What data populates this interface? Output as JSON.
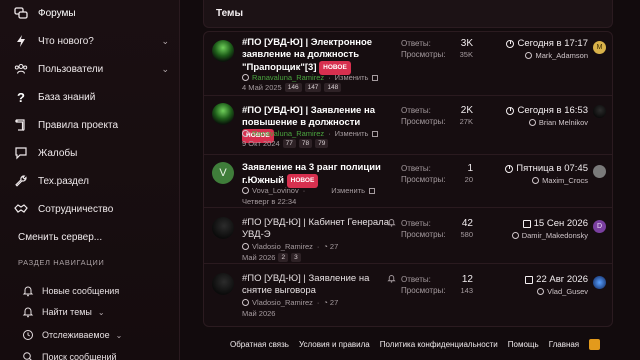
{
  "sidebar": {
    "items": [
      {
        "label": "Форумы",
        "icon": "chat-bubbles-icon"
      },
      {
        "label": "Что нового?",
        "icon": "lightning-icon"
      },
      {
        "label": "Пользователи",
        "icon": "users-icon"
      },
      {
        "label": "База знаний",
        "icon": "question-icon"
      },
      {
        "label": "Правила проекта",
        "icon": "scroll-icon"
      },
      {
        "label": "Жалобы",
        "icon": "chat-warning-icon"
      },
      {
        "label": "Тех.раздел",
        "icon": "wrench-icon"
      },
      {
        "label": "Сотрудничество",
        "icon": "handshake-icon"
      }
    ],
    "change_server": "Сменить сервер...",
    "nav_heading": "РАЗДЕЛ НАВИГАЦИИ",
    "nav_items": [
      {
        "label": "Новые сообщения",
        "icon": "bell-outline-icon"
      },
      {
        "label": "Найти темы",
        "icon": "bell-outline-icon"
      },
      {
        "label": "Отслеживаемое",
        "icon": "clock-icon"
      },
      {
        "label": "Поиск сообщений",
        "icon": "search-icon"
      }
    ]
  },
  "main": {
    "header": "Темы",
    "labels": {
      "replies": "Ответы:",
      "views": "Просмотры:",
      "edit": "Изменить",
      "new_badge": "НОВОЕ"
    },
    "threads": [
      {
        "title": "#ПО [УВД-Ю] | Электронное заявление на должность \"Прапорщик\"[3]",
        "is_new": true,
        "author": "Ranavaluna_Ramirez",
        "author_green": true,
        "date": "4 Май 2025",
        "pages": [
          "146",
          "147",
          "148"
        ],
        "replies": "3K",
        "views": "35K",
        "last_date": "Сегодня в 17:17",
        "last_user": "Mark_Adamson",
        "mini_avatar": "M",
        "mini_color": "#d9b24a"
      },
      {
        "title": "#ПО [УВД-Ю] | Заявление на повышение в должности",
        "is_new": true,
        "author": "Ranavaluna_Ramirez",
        "author_green": true,
        "date": "9 Окт 2024",
        "pages": [
          "77",
          "78",
          "79"
        ],
        "replies": "2K",
        "views": "27K",
        "last_date": "Сегодня в 16:53",
        "last_user": "Brian Melnikov",
        "mini_avatar": "",
        "mini_color": "#1a1a1a"
      },
      {
        "title": "Заявление на 3 ранг полиции г.Южный",
        "is_new": true,
        "author": "Vova_Lovinov",
        "author_green": false,
        "date": "Четверг в 22:34",
        "pages": [],
        "replies": "1",
        "views": "20",
        "last_date": "Пятница в 07:45",
        "last_user": "Maxim_Crocs",
        "mini_avatar": "",
        "mini_color": "#7a7a7a"
      },
      {
        "title": "#ПО [УВД-Ю] | Кабинет Генерала УВД-Э",
        "is_new": false,
        "author": "Vladosio_Ramirez",
        "author_green": false,
        "replies_inline": "27",
        "date": "Май 2026",
        "pages": [
          "2",
          "3"
        ],
        "replies": "42",
        "views": "580",
        "last_date": "15 Сен 2026",
        "last_user": "Damir_Makedonsky",
        "mini_avatar": "D",
        "mini_color": "#7a3fa0"
      },
      {
        "title": "#ПО [УВД-Ю] | Заявление на снятие выговора",
        "is_new": false,
        "author": "Vladosio_Ramirez",
        "author_green": false,
        "replies_inline": "27",
        "date": "Май 2026",
        "pages": [],
        "replies": "12",
        "views": "143",
        "last_date": "22 Авг 2026",
        "last_user": "Vlad_Gusev",
        "mini_avatar": "",
        "mini_color": "#2c6bc2"
      }
    ]
  },
  "footer": {
    "links": [
      "Обратная связь",
      "Условия и правила",
      "Политика конфиденциальности",
      "Помощь",
      "Главная"
    ]
  },
  "colors": {
    "accent": "#d7304f",
    "green_user": "#4aa53f",
    "rss": "#e39a1c"
  }
}
